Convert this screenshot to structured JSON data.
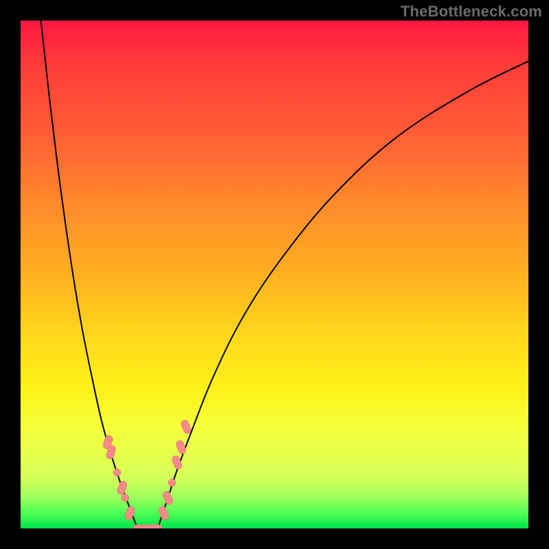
{
  "watermark": "TheBottleneck.com",
  "colors": {
    "top": "#ff1744",
    "mid": "#ffd81a",
    "bottom": "#00e24a",
    "curve": "#000000",
    "marker": "#f58a8a"
  },
  "chart_data": {
    "type": "line",
    "title": "",
    "xlabel": "",
    "ylabel": "",
    "xlim": [
      0,
      100
    ],
    "ylim": [
      0,
      100
    ],
    "note": "V-shaped bottleneck curve; y-axis plotted inverted (0 at top, 100 at bottom). Values approximate — chart has no numeric axis labels.",
    "series": [
      {
        "name": "bottleneck-curve-left",
        "x": [
          4,
          6,
          8,
          10,
          12,
          14,
          16,
          18,
          20,
          21.5,
          23
        ],
        "y": [
          0,
          18,
          34,
          48,
          60,
          70,
          79,
          86,
          92,
          96,
          100
        ]
      },
      {
        "name": "bottleneck-curve-right",
        "x": [
          27,
          29,
          31,
          34,
          38,
          44,
          52,
          62,
          74,
          88,
          100
        ],
        "y": [
          100,
          94,
          88,
          80,
          70,
          58,
          46,
          34,
          23,
          14,
          8
        ]
      },
      {
        "name": "curve-plateau",
        "x": [
          23,
          25,
          27
        ],
        "y": [
          100,
          100,
          100
        ]
      }
    ],
    "markers": [
      {
        "x": 17.2,
        "y": 83,
        "shape": "capsule"
      },
      {
        "x": 17.8,
        "y": 85,
        "shape": "capsule"
      },
      {
        "x": 19.0,
        "y": 89,
        "shape": "dot"
      },
      {
        "x": 20.0,
        "y": 92,
        "shape": "capsule"
      },
      {
        "x": 20.6,
        "y": 94,
        "shape": "dot"
      },
      {
        "x": 21.5,
        "y": 97,
        "shape": "capsule"
      },
      {
        "x": 23.3,
        "y": 100,
        "shape": "capsule-h"
      },
      {
        "x": 25.0,
        "y": 100,
        "shape": "capsule-h"
      },
      {
        "x": 26.7,
        "y": 100,
        "shape": "capsule-h"
      },
      {
        "x": 28.2,
        "y": 97,
        "shape": "capsule"
      },
      {
        "x": 29.0,
        "y": 94,
        "shape": "capsule"
      },
      {
        "x": 29.8,
        "y": 91,
        "shape": "dot"
      },
      {
        "x": 30.8,
        "y": 87,
        "shape": "capsule"
      },
      {
        "x": 31.6,
        "y": 84,
        "shape": "capsule"
      },
      {
        "x": 32.6,
        "y": 80,
        "shape": "capsule"
      }
    ]
  }
}
